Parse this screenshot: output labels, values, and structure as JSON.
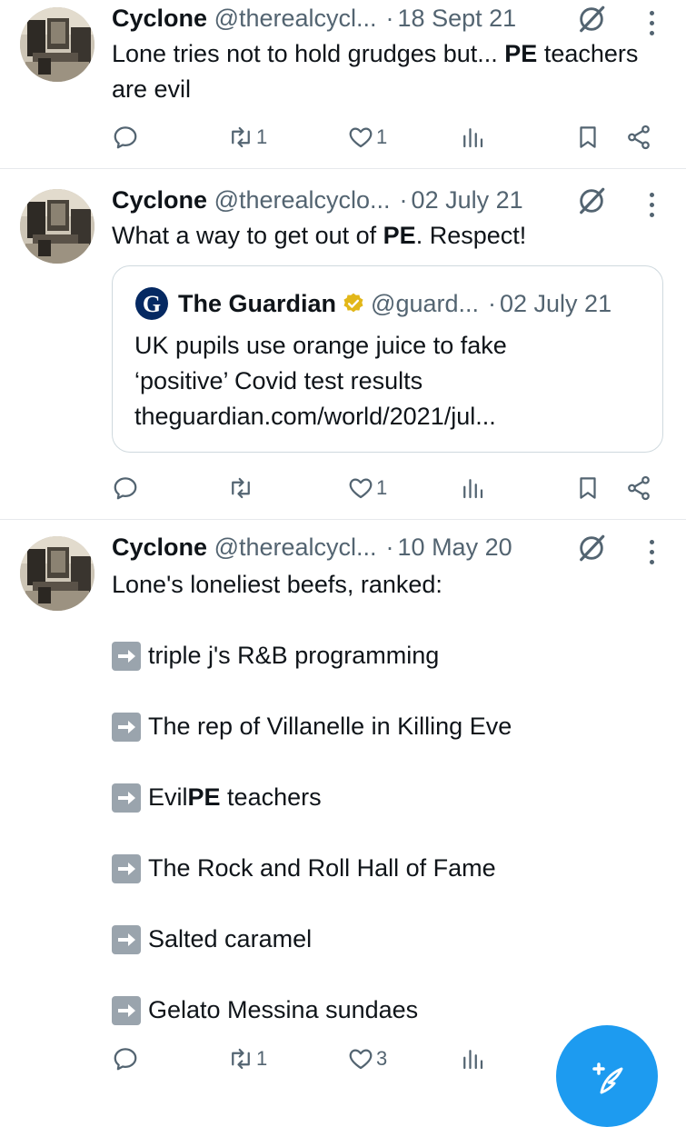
{
  "tweets": [
    {
      "name": "Cyclone",
      "handle": "@therealcycl...",
      "date": "18 Sept 21",
      "text_before": "Lone tries not to hold grudges but... ",
      "text_bold": "PE",
      "text_after": " teachers are evil",
      "actions": {
        "reply": "",
        "retweet": "1",
        "like": "1",
        "views": ""
      }
    },
    {
      "name": "Cyclone",
      "handle": "@therealcyclo...",
      "date": "02 July 21",
      "text_before": "What a way to get out of ",
      "text_bold": "PE",
      "text_after": ". Respect!",
      "quote": {
        "name": "The Guardian",
        "handle": "@guard...",
        "date": "02 July 21",
        "text_line1": "UK pupils use orange juice to fake",
        "text_line2": "‘positive’ Covid test results",
        "link": "theguardian.com/world/2021/jul..."
      },
      "actions": {
        "reply": "",
        "retweet": "",
        "like": "1",
        "views": ""
      }
    },
    {
      "name": "Cyclone",
      "handle": "@therealcycl...",
      "date": "10 May 20",
      "text": "Lone's loneliest beefs, ranked:",
      "list": [
        {
          "before": "triple j's R&B programming",
          "bold": "",
          "after": ""
        },
        {
          "before": "The rep of Villanelle in Killing Eve",
          "bold": "",
          "after": ""
        },
        {
          "before": "Evil ",
          "bold": "PE",
          "after": " teachers"
        },
        {
          "before": "The Rock and Roll Hall of Fame",
          "bold": "",
          "after": ""
        },
        {
          "before": "Salted caramel",
          "bold": "",
          "after": ""
        },
        {
          "before": "Gelato Messina sundaes",
          "bold": "",
          "after": ""
        }
      ],
      "actions": {
        "reply": "",
        "retweet": "1",
        "like": "3",
        "views": ""
      }
    }
  ],
  "icons": {
    "reply": "reply-icon",
    "retweet": "retweet-icon",
    "like": "heart-icon",
    "views": "views-icon",
    "bookmark": "bookmark-icon",
    "share": "share-icon",
    "grok": "grok-icon",
    "more": "more-icon",
    "list_bullet": "right-arrow-emoji-icon",
    "compose": "compose-icon"
  },
  "colors": {
    "accent": "#1d9bf0",
    "muted": "#536471",
    "verified": "#e2b719"
  }
}
